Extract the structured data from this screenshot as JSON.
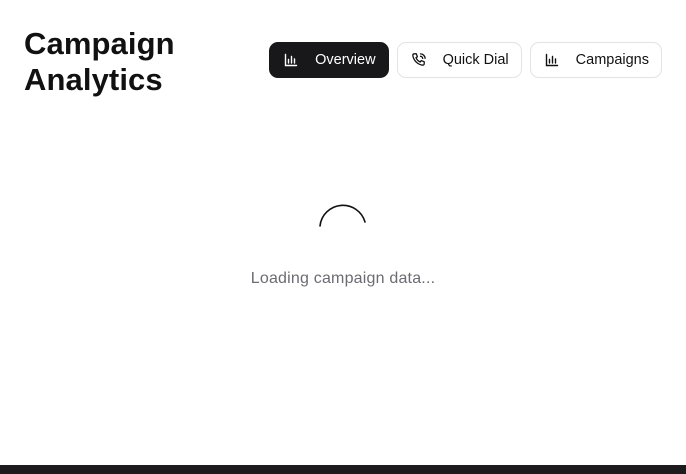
{
  "header": {
    "title_line1": "Campaign",
    "title_line2": "Analytics"
  },
  "nav": {
    "items": [
      {
        "label": "Overview",
        "icon": "bar-chart-icon",
        "active": true
      },
      {
        "label": "Quick Dial",
        "icon": "phone-icon",
        "active": false
      },
      {
        "label": "Campaigns",
        "icon": "bar-chart-icon",
        "active": false
      }
    ]
  },
  "status": {
    "loading_text": "Loading campaign data..."
  },
  "colors": {
    "active_tab_bg": "#18181b",
    "text_muted": "#6b6b72",
    "border": "#e3e3e6"
  }
}
